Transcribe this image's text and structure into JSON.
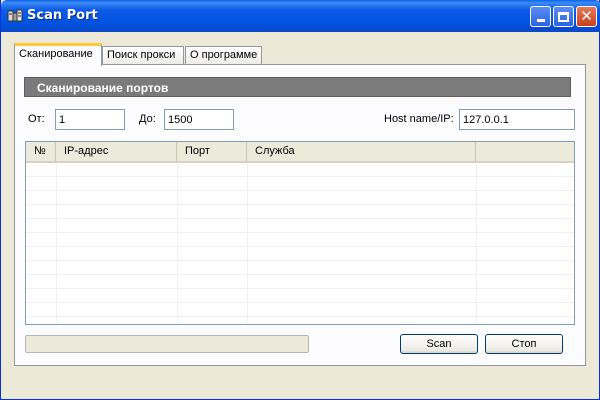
{
  "window": {
    "title": "Scan Port",
    "icon": "network-scanner-icon"
  },
  "tabs": [
    {
      "label": "Сканирование",
      "active": true
    },
    {
      "label": "Поиск прокси",
      "active": false
    },
    {
      "label": "О программе",
      "active": false
    }
  ],
  "section": {
    "title": "Сканирование портов"
  },
  "form": {
    "from_label": "От:",
    "from_value": "1",
    "to_label": "До:",
    "to_value": "1500",
    "host_label": "Host name/IP:",
    "host_value": "127.0.0.1"
  },
  "table": {
    "columns": [
      "№",
      "IP-адрес",
      "Порт",
      "Служба",
      ""
    ],
    "rows": []
  },
  "progress": {
    "value": 0
  },
  "buttons": {
    "scan": "Scan",
    "stop": "Стоп"
  }
}
